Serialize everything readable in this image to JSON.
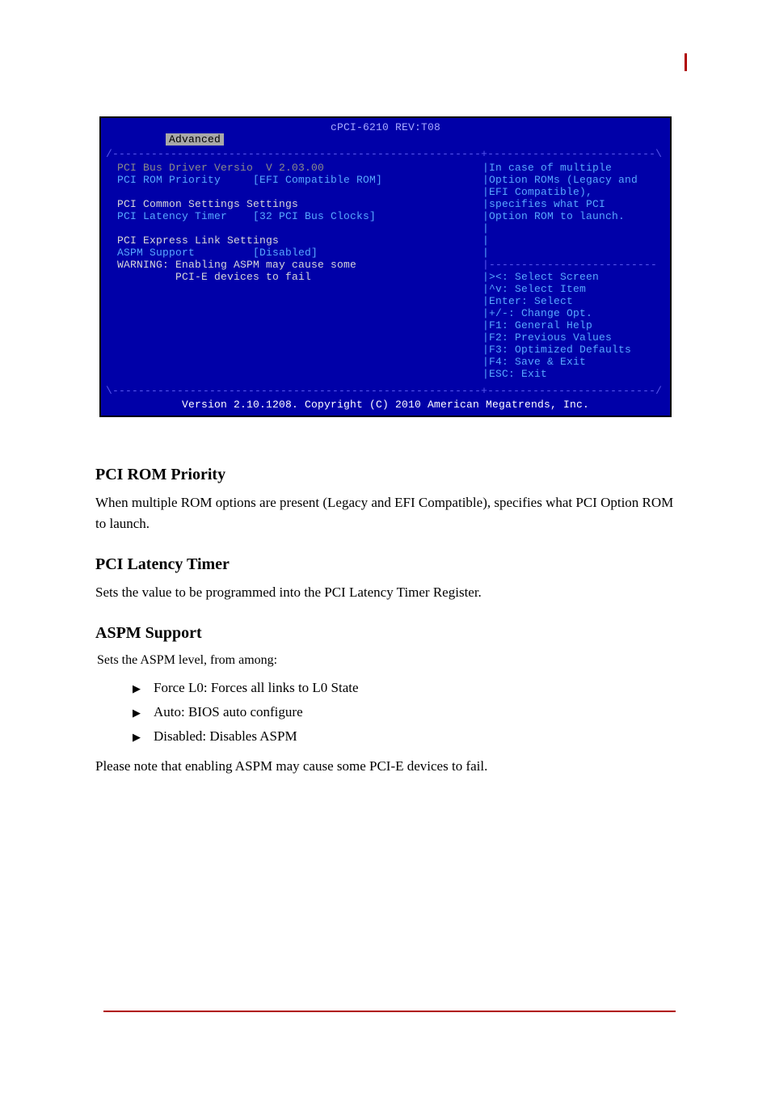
{
  "bios": {
    "title": "cPCI-6210 REV:T08",
    "tab": "Advanced",
    "top_sep": "/---------------------------------------------------------+--------------------------\\",
    "left": {
      "r1_label": "PCI Bus Driver Versio",
      "r1_value": "  V 2.03.00",
      "r2_label": "PCI ROM Priority",
      "r2_value": "     [EFI Compatible ROM]",
      "section1": "PCI Common Settings Settings",
      "r3_label": "PCI Latency Timer",
      "r3_value": "    [32 PCI Bus Clocks]",
      "section2": "PCI Express Link Settings",
      "r4_label": "ASPM Support",
      "r4_value": "         [Disabled]",
      "warn1": "WARNING: Enabling ASPM may cause some",
      "warn2": "         PCI-E devices to fail"
    },
    "right": {
      "help1": "|In case of multiple",
      "help2": "|Option ROMs (Legacy and",
      "help3": "|EFI Compatible),",
      "help4": "|specifies what PCI",
      "help5": "|Option ROM to launch.",
      "help6": "|",
      "help7": "|",
      "help8": "|",
      "sep": "|--------------------------",
      "k1": "|><: Select Screen",
      "k2": "|^v: Select Item",
      "k3": "|Enter: Select",
      "k4": "|+/-: Change Opt.",
      "k5": "|F1: General Help",
      "k6": "|F2: Previous Values",
      "k7": "|F3: Optimized Defaults",
      "k8": "|F4: Save & Exit",
      "k9": "|ESC: Exit"
    },
    "bottom_sep": "\\---------------------------------------------------------+--------------------------/",
    "footer": "Version 2.10.1208. Copyright (C) 2010 American Megatrends, Inc."
  },
  "doc": {
    "h_rom": "PCI ROM Priority",
    "p_rom": "When multiple ROM options are present (Legacy and EFI Compatible), specifies what PCI Option ROM to launch.",
    "h_lat": "PCI Latency Timer",
    "p_lat": "Sets the value to be programmed into the PCI Latency Timer Register.",
    "h_aspm": "ASPM Support",
    "p_aspm": "Sets the ASPM level, from among:",
    "opt1": "Force L0: Forces all links to L0 State",
    "opt2": "Auto: BIOS auto configure",
    "opt3": "Disabled: Disables ASPM",
    "p_warn": "Please note that enabling ASPM may cause some PCI-E devices to fail."
  }
}
